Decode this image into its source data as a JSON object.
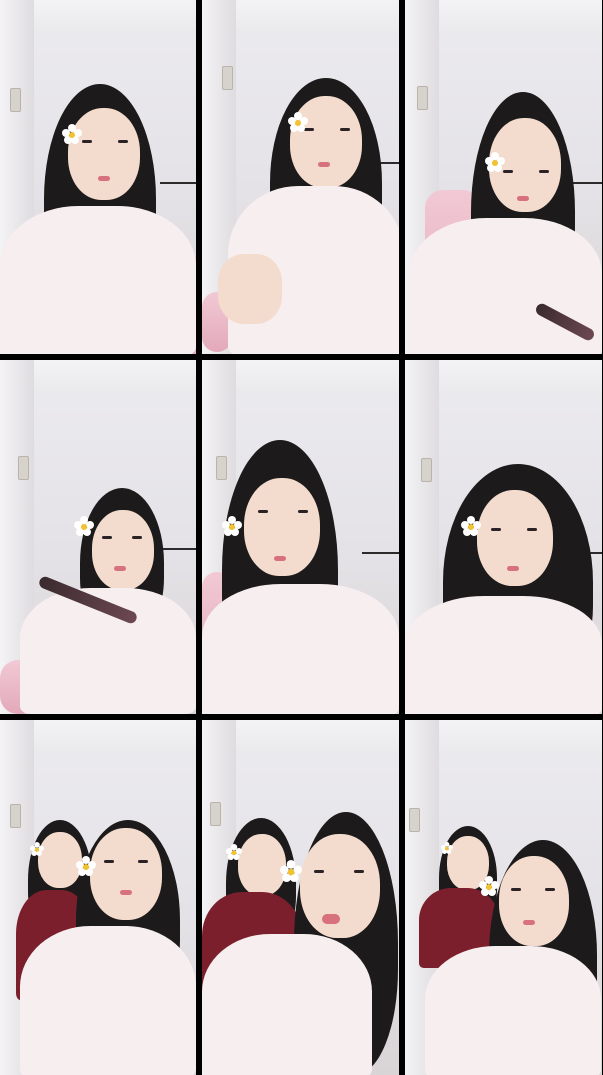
{
  "grid": {
    "columns": 3,
    "rows": 3,
    "frames": [
      {
        "id": 1,
        "people": 1,
        "sticker": "flower-icon",
        "prop": "none"
      },
      {
        "id": 2,
        "people": 1,
        "sticker": "flower-icon",
        "prop": "none"
      },
      {
        "id": 3,
        "people": 1,
        "sticker": "flower-icon",
        "prop": "hair-straightener"
      },
      {
        "id": 4,
        "people": 1,
        "sticker": "flower-icon",
        "prop": "hair-straightener"
      },
      {
        "id": 5,
        "people": 1,
        "sticker": "flower-icon",
        "prop": "none"
      },
      {
        "id": 6,
        "people": 1,
        "sticker": "flower-icon",
        "prop": "none"
      },
      {
        "id": 7,
        "people": 2,
        "sticker": "flower-icon",
        "prop": "none"
      },
      {
        "id": 8,
        "people": 2,
        "sticker": "flower-icon",
        "prop": "none"
      },
      {
        "id": 9,
        "people": 2,
        "sticker": "flower-icon",
        "prop": "none"
      }
    ]
  },
  "colors": {
    "separator": "#000000",
    "wall": "#e6e4e8",
    "chair": "#eab6c4",
    "shirt_white": "#f7eef0",
    "shirt_maroon": "#7a1f2b",
    "hair": "#1d1a1b",
    "flower_petal": "#ffffff",
    "flower_center": "#f2c230"
  }
}
